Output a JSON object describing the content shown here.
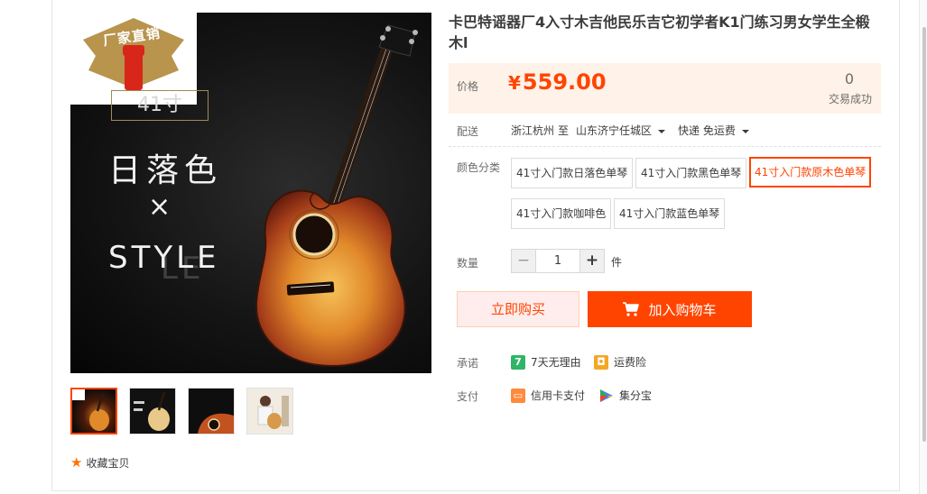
{
  "gallery": {
    "badge_text": "厂家直销",
    "size_text": "41寸",
    "color_text": "日落色",
    "times_text": "×",
    "style_text": "STYLE",
    "style_shadow_text": "LE",
    "favorite_label": "收藏宝贝"
  },
  "product": {
    "title": "卡巴特谣器厂4入寸木吉他民乐吉它初学者K1门练习男女学生全椴木l",
    "price_label": "价格",
    "currency": "¥",
    "price": "559.00",
    "sold_count": "0",
    "sold_label": "交易成功"
  },
  "shipping": {
    "label": "配送",
    "from": "浙江杭州",
    "to_word": "至",
    "destination": "山东济宁任城区",
    "method": "快递 免运费"
  },
  "color_options": {
    "label": "颜色分类",
    "items": [
      {
        "text": "41寸入门款日落色单琴",
        "selected": false
      },
      {
        "text": "41寸入门款黑色单琴",
        "selected": false
      },
      {
        "text": "41寸入门款原木色单琴",
        "selected": true
      },
      {
        "text": "41寸入门款咖啡色",
        "selected": false
      },
      {
        "text": "41寸入门款蓝色单琴",
        "selected": false
      }
    ]
  },
  "quantity": {
    "label": "数量",
    "value": "1",
    "minus": "−",
    "plus": "+",
    "unit": "件"
  },
  "actions": {
    "buy_now": "立即购买",
    "add_to_cart": "加入购物车"
  },
  "promise": {
    "label": "承诺",
    "items": [
      {
        "icon": "seven-day-icon",
        "icon_glyph": "7",
        "text": "7天无理由",
        "color": "#2fb566"
      },
      {
        "icon": "shipping-insurance-icon",
        "icon_glyph": "◘",
        "text": "运费险",
        "color": "#f5a623"
      }
    ]
  },
  "payment": {
    "label": "支付",
    "items": [
      {
        "icon": "credit-card-icon",
        "icon_glyph": "▭",
        "text": "信用卡支付",
        "color": "#ff8a3d"
      },
      {
        "icon": "jifenbao-icon",
        "icon_glyph": "▶",
        "text": "集分宝"
      }
    ]
  },
  "colors": {
    "accent": "#ff4400",
    "price_bg": "#fff2e8",
    "buy_now_bg": "#ffeded"
  }
}
